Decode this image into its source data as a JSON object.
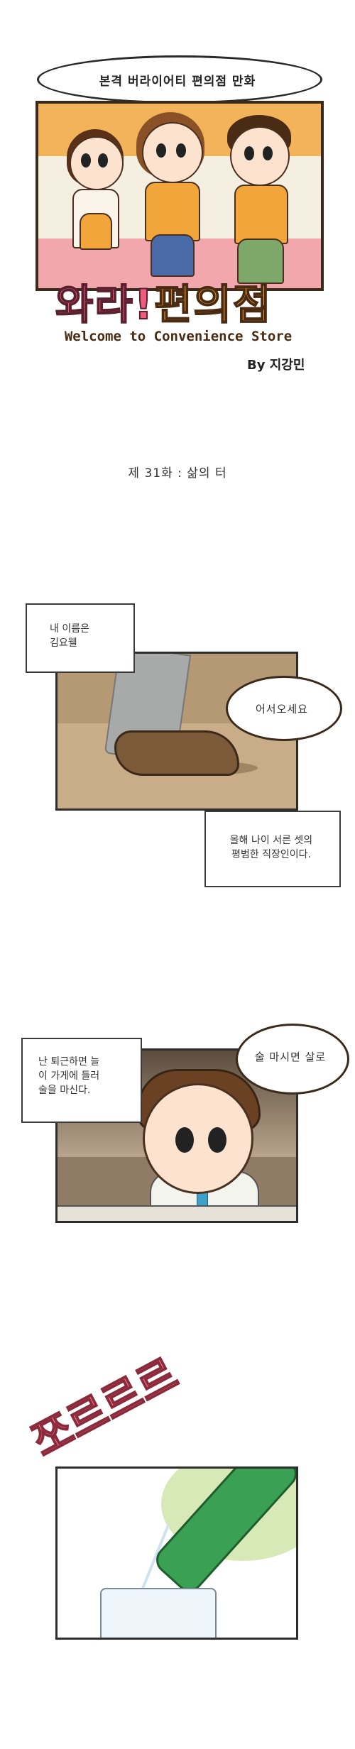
{
  "header": {
    "tagline": "본격 버라이어티 편의점 만화",
    "logo_part1": "와라!",
    "logo_part2": "편의점",
    "subtitle": "Welcome to Convenience Store",
    "byline": "By 지강민"
  },
  "episode": {
    "title": "제 31화 : 삶의 터"
  },
  "panel1": {
    "caption_top": [
      "내 이름은",
      "김요웰"
    ],
    "bubble": "어서오세요",
    "caption_bottom": [
      "올해 나이 서른 셋의",
      "평범한 직장인이다."
    ]
  },
  "panel2": {
    "caption": [
      "난 퇴근하면 늘",
      "이 가게에 들러",
      "술을 마신다."
    ],
    "bubble": "술 마시면 살로"
  },
  "panel3": {
    "sfx": "쪼르르르"
  }
}
